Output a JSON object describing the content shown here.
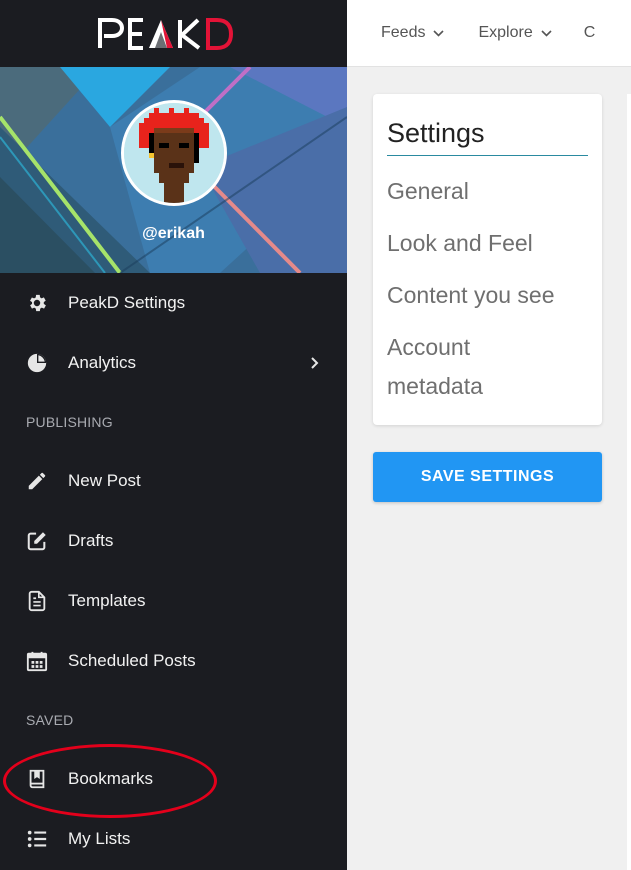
{
  "logo": {
    "text_left": "PE",
    "text_right": "KD",
    "accent_color": "#e31337"
  },
  "profile": {
    "username": "@erikah"
  },
  "sidebar": {
    "items": [
      {
        "label": "PeakD Settings",
        "icon": "gear-icon"
      },
      {
        "label": "Analytics",
        "icon": "pie-chart-icon",
        "has_submenu": true
      }
    ],
    "sections": [
      {
        "label": "PUBLISHING",
        "items": [
          {
            "label": "New Post",
            "icon": "pencil-icon"
          },
          {
            "label": "Drafts",
            "icon": "edit-square-icon"
          },
          {
            "label": "Templates",
            "icon": "document-icon"
          },
          {
            "label": "Scheduled Posts",
            "icon": "calendar-icon"
          }
        ]
      },
      {
        "label": "SAVED",
        "items": [
          {
            "label": "Bookmarks",
            "icon": "bookmark-book-icon",
            "highlighted": true
          },
          {
            "label": "My Lists",
            "icon": "list-icon"
          }
        ]
      }
    ]
  },
  "topnav": {
    "items": [
      {
        "label": "Feeds"
      },
      {
        "label": "Explore"
      },
      {
        "label": "C"
      }
    ]
  },
  "settings": {
    "title": "Settings",
    "links": [
      "General",
      "Look and Feel",
      "Content you see",
      "Account metadata"
    ],
    "save_label": "SAVE SETTINGS"
  },
  "colors": {
    "sidebar_bg": "#1b1c21",
    "primary_button": "#2196f3",
    "highlight_circle": "#e3001b"
  }
}
